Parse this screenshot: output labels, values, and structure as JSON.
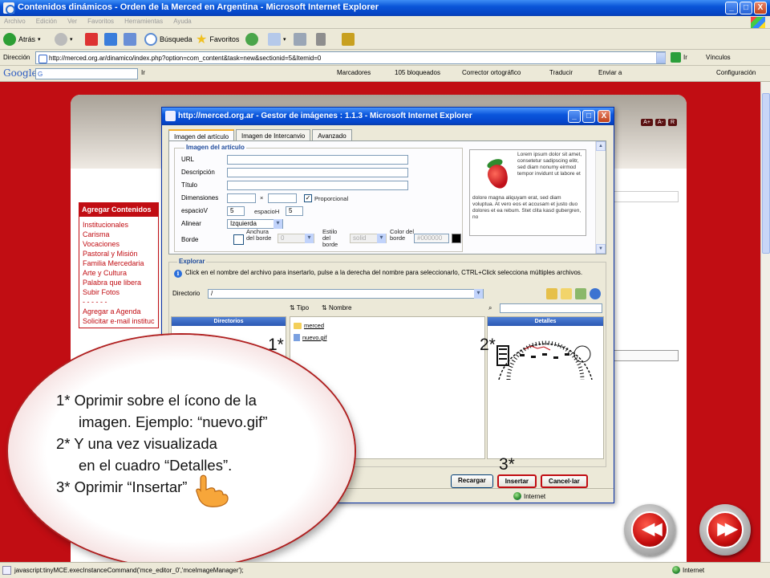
{
  "window": {
    "title": "Contenidos dinámicos - Orden de la Merced en Argentina - Microsoft Internet Explorer",
    "controls": [
      "_",
      "□",
      "X"
    ]
  },
  "menu": [
    "Archivo",
    "Edición",
    "Ver",
    "Favoritos",
    "Herramientas",
    "Ayuda"
  ],
  "toolbar": {
    "back": "Atrás",
    "search": "Búsqueda",
    "favorites": "Favoritos"
  },
  "address": {
    "label": "Dirección",
    "url": "http://merced.org.ar/dinamico/index.php?option=com_content&task=new&sectionid=5&Itemid=0",
    "go": "Ir",
    "links": "Vínculos"
  },
  "google_toolbar": {
    "logo": "Google",
    "box": "G",
    "go": "Ir",
    "bookmarks": "Marcadores",
    "blocked": "105 bloqueados",
    "spell": "Corrector ortográfico",
    "translate": "Traducir",
    "send": "Enviar a",
    "settings": "Configuración"
  },
  "site": {
    "font_buttons": [
      "A+",
      "A-",
      "R"
    ],
    "sidebar_title": "Agregar Contenidos",
    "sidebar_links": [
      "Institucionales",
      "Carisma",
      "Vocaciones",
      "Pastoral y Misión",
      "Familia Mercedaria",
      "Arte y Cultura",
      "Palabra que libera",
      "Subir Fotos"
    ],
    "separator": "- - - - - -",
    "sidebar_links2": [
      "Agregar a Agenda",
      "Solicitar e-mail institucional"
    ]
  },
  "popup": {
    "title": "http://merced.org.ar - Gestor de imágenes : 1.1.3 - Microsoft Internet Explorer",
    "controls": [
      "_",
      "□",
      "X"
    ],
    "tabs": [
      "Imagen del artículo",
      "Imagen de Intercanvio",
      "Avanzado"
    ],
    "fieldset_title": "Imagen del artículo",
    "fields": {
      "url": "URL",
      "description": "Descripción",
      "title": "Título",
      "dimensions": "Dimensiones",
      "x": "×",
      "proportional": "Proporcional",
      "vspace": "espacioV",
      "vspace_val": "5",
      "hspace": "espacioH",
      "hspace_val": "5",
      "align": "Alinear",
      "align_val": "Izquierda",
      "border": "Borde",
      "border_width": "Anchura del borde",
      "border_width_val": "0",
      "border_style": "Estilo del borde",
      "border_style_val": "solid",
      "border_color": "Color del borde",
      "border_color_val": "#000000"
    },
    "preview_text_right": "Lorem ipsum dolor sit amet, consetetur sadipscing elitr, sed diam nonumy eirmod tempor invidunt ut labore et",
    "preview_text_bottom": "dolore magna aliquyam erat, sed diam voluptua. At vero eos et accusam et justo duo dolores et ea rebum. Stet clita kasd gubergren, no",
    "explore_title": "Explorar",
    "info": "Click en el nombre del archivo para insertarlo, pulse a la derecha del nombre para seleccionarlo, CTRL+Click selecciona múltiples archivos.",
    "dir_label": "Directorio",
    "dir_value": "/",
    "col_type": "Tipo",
    "col_name": "Nombre",
    "pane_dirs": "Directorios",
    "pane_details": "Detalles",
    "files": [
      "merced",
      "nuevo.gif"
    ],
    "buttons": [
      "Recargar",
      "Insertar",
      "Cancel·lar"
    ],
    "status_zone": "Internet"
  },
  "annotations": {
    "m1": "1*",
    "m2": "2*",
    "m3": "3*",
    "lines": [
      "1* Oprimir sobre el ícono de la",
      "imagen. Ejemplo: “nuevo.gif”",
      "2* Y una vez visualizada",
      "en el cuadro “Detalles”.",
      "3* Oprimir “Insertar”"
    ]
  },
  "nav": {
    "prev": "◀◀",
    "next": "▶▶"
  },
  "status": {
    "text": "javascript:tinyMCE.execInstanceCommand('mce_editor_0','mceImageManager');",
    "zone": "Internet"
  }
}
